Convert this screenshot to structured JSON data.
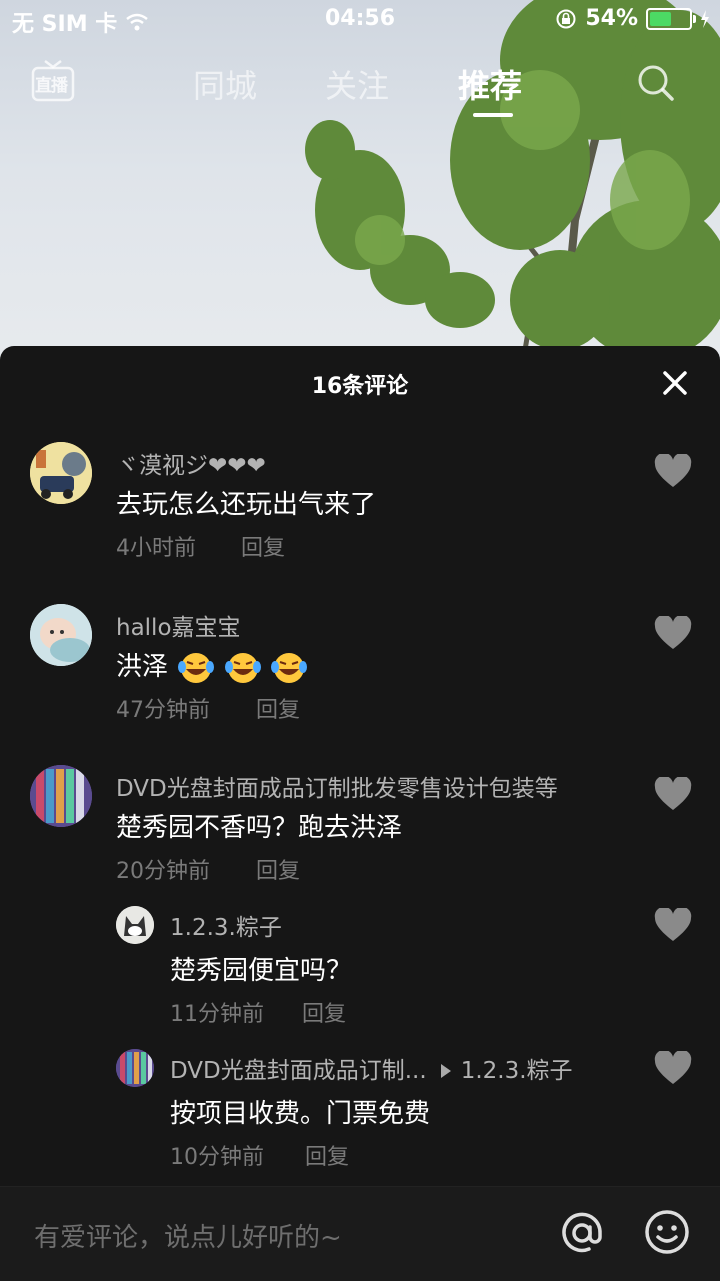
{
  "status_bar": {
    "carrier": "无 SIM 卡",
    "time": "04:56",
    "battery": "54%",
    "battery_level": 0.54
  },
  "top_nav": {
    "live_label": "直播",
    "tabs": [
      "同城",
      "关注",
      "推荐"
    ],
    "active_tab": "推荐"
  },
  "comments_sheet": {
    "title": "16条评论",
    "comments": [
      {
        "username": "ヾ漠视ジ❤❤❤",
        "text": "去玩怎么还玩出气来了",
        "time": "4小时前",
        "reply_label": "回复"
      },
      {
        "username": "hallo嘉宝宝",
        "text": "洪泽",
        "time": "47分钟前",
        "reply_label": "回复"
      },
      {
        "username": "DVD光盘封面成品订制批发零售设计包装等",
        "text": "楚秀园不香吗？跑去洪泽",
        "time": "20分钟前",
        "reply_label": "回复"
      }
    ],
    "replies": [
      {
        "username": "1.2.3.粽子",
        "text": "楚秀园便宜吗？",
        "time": "11分钟前",
        "reply_label": "回复"
      },
      {
        "username": "DVD光盘封面成品订制...",
        "reply_to": "1.2.3.粽子",
        "text": "按项目收费。门票免费",
        "time": "10分钟前",
        "reply_label": "回复"
      }
    ]
  },
  "input_bar": {
    "placeholder": "有爱评论，说点儿好听的~"
  },
  "colors": {
    "sheet_bg": "#161616",
    "battery_green": "#4cd964",
    "muted_text": "#7a7a7a",
    "username_text": "#b3b3b3"
  }
}
